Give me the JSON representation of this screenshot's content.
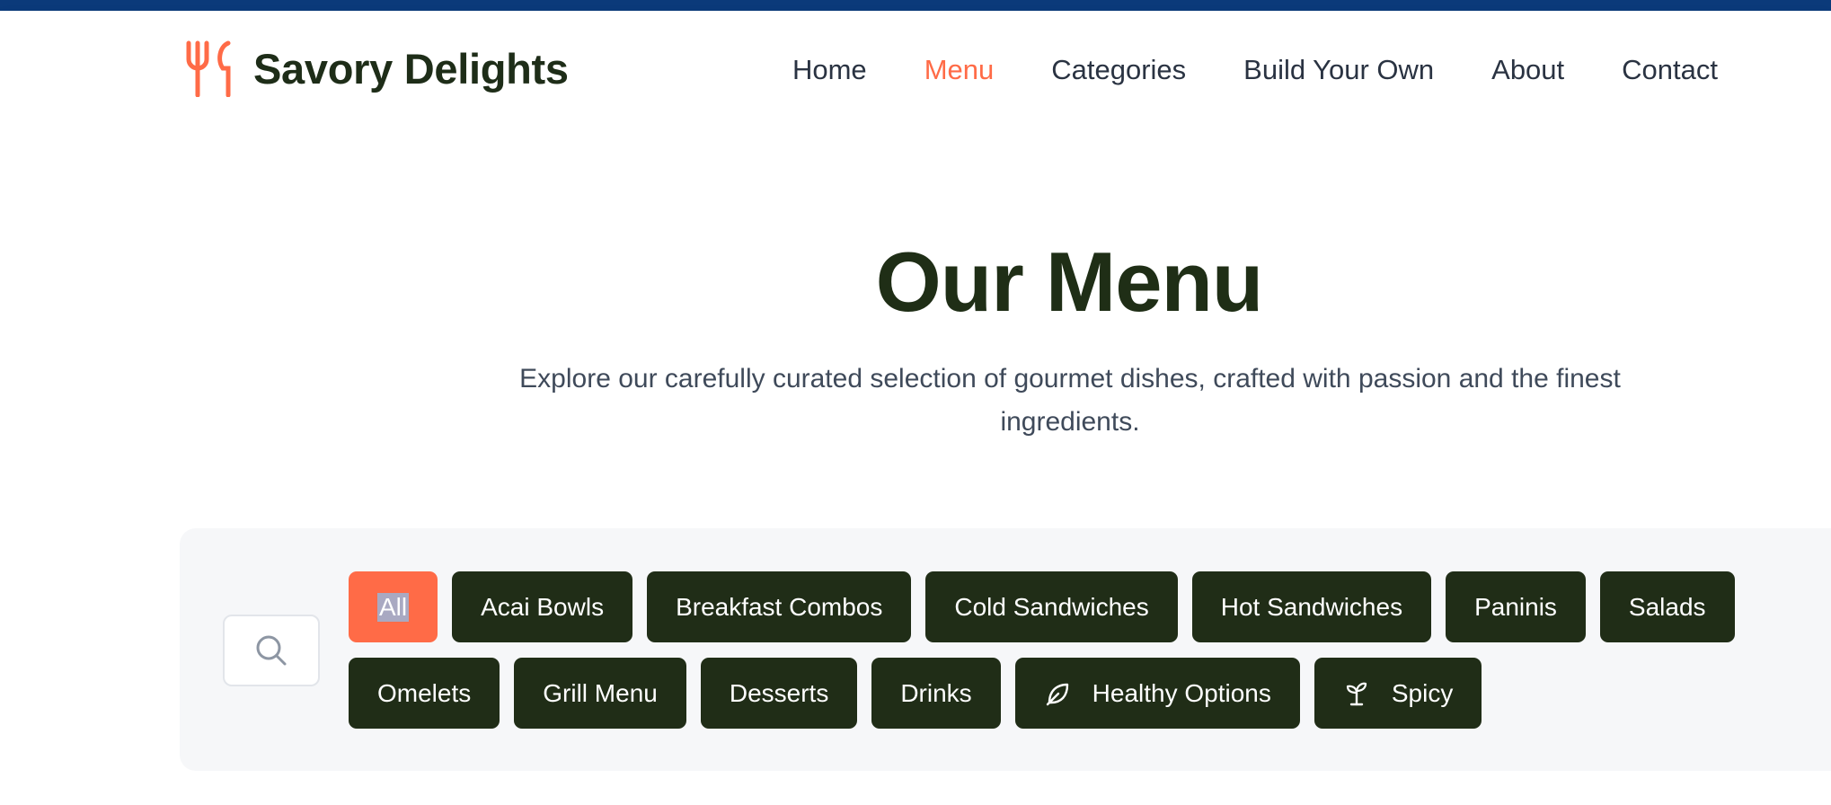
{
  "brand": {
    "name": "Savory Delights",
    "icon": "fork-knife-icon",
    "accent": "#ff6b47",
    "dark": "#1f2e16"
  },
  "nav": {
    "items": [
      {
        "label": "Home",
        "active": false
      },
      {
        "label": "Menu",
        "active": true
      },
      {
        "label": "Categories",
        "active": false
      },
      {
        "label": "Build Your Own",
        "active": false
      },
      {
        "label": "About",
        "active": false
      },
      {
        "label": "Contact",
        "active": false
      }
    ]
  },
  "hero": {
    "title": "Our Menu",
    "subtitle": "Explore our carefully curated selection of gourmet dishes, crafted with passion and the finest ingredients."
  },
  "filters": {
    "search_icon": "search-icon",
    "row1": [
      "All",
      "Acai Bowls",
      "Breakfast Combos",
      "Cold Sandwiches",
      "Hot Sandwiches",
      "Paninis",
      "Salads"
    ],
    "row2": [
      "Omelets",
      "Grill Menu",
      "Desserts",
      "Drinks",
      "Healthy Options",
      "Spicy"
    ],
    "active": "All",
    "healthy_icon": "leaf-icon",
    "spicy_icon": "sprout-icon"
  }
}
